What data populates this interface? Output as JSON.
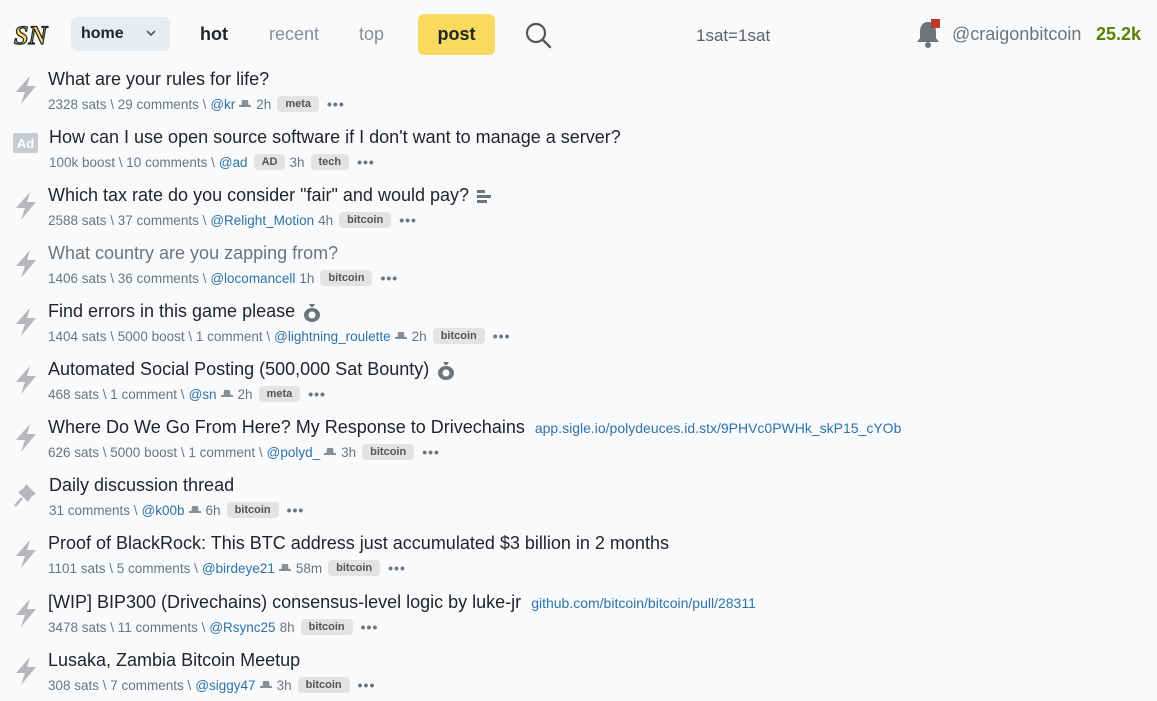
{
  "header": {
    "logo_text": "SN",
    "home_label": "home",
    "nav": {
      "hot": "hot",
      "recent": "recent",
      "top": "top"
    },
    "post_label": "post",
    "price": "1sat=1sat",
    "username": "@craigonbitcoin",
    "balance": "25.2k"
  },
  "items": [
    {
      "title": "What are your rules for life?",
      "stats": "2328 sats \\ 29 comments \\",
      "user": "@kr",
      "time": "2h",
      "tag": "meta"
    },
    {
      "title": "How can I use open source software if I don't want to manage a server?",
      "stats": "100k boost \\ 10 comments \\",
      "user": "@ad",
      "ad_badge": "AD",
      "time": "3h",
      "tag": "tech",
      "ad_icon": "Ad"
    },
    {
      "title": "Which tax rate do you consider \"fair\" and would pay?",
      "stats": "2588 sats \\ 37 comments \\",
      "user": "@Relight_Motion",
      "time": "4h",
      "tag": "bitcoin"
    },
    {
      "title": "What country are you zapping from?",
      "stats": "1406 sats \\ 36 comments \\",
      "user": "@locomancell",
      "time": "1h",
      "tag": "bitcoin"
    },
    {
      "title": "Find errors in this game please",
      "stats": "1404 sats \\ 5000 boost \\ 1 comment \\",
      "user": "@lightning_roulette",
      "time": "2h",
      "tag": "bitcoin"
    },
    {
      "title": "Automated Social Posting (500,000 Sat Bounty)",
      "stats": "468 sats \\ 1 comment \\",
      "user": "@sn",
      "time": "2h",
      "tag": "meta"
    },
    {
      "title": "Where Do We Go From Here? My Response to Drivechains",
      "url": "app.sigle.io/polydeuces.id.stx/9PHVc0PWHk_skP15_cYOb",
      "stats": "626 sats \\ 5000 boost \\ 1 comment \\",
      "user": "@polyd_",
      "time": "3h",
      "tag": "bitcoin"
    },
    {
      "title": "Daily discussion thread",
      "stats": "31 comments \\",
      "user": "@k00b",
      "time": "6h",
      "tag": "bitcoin"
    },
    {
      "title": "Proof of BlackRock: This BTC address just accumulated $3 billion in 2 months",
      "stats": "1101 sats \\ 5 comments \\",
      "user": "@birdeye21",
      "time": "58m",
      "tag": "bitcoin"
    },
    {
      "title": "[WIP] BIP300 (Drivechains) consensus-level logic by luke-jr",
      "url": "github.com/bitcoin/bitcoin/pull/28311",
      "stats": "3478 sats \\ 11 comments \\",
      "user": "@Rsync25",
      "time": "8h",
      "tag": "bitcoin"
    },
    {
      "title": "Lusaka, Zambia Bitcoin Meetup",
      "stats": "308 sats \\ 7 comments \\",
      "user": "@siggy47",
      "time": "3h",
      "tag": "bitcoin"
    }
  ],
  "more_label": "•••",
  "colors": {
    "accent": "#fada5e",
    "link": "#2c73a8",
    "balance": "#5c8001",
    "notification": "#c0392b"
  }
}
